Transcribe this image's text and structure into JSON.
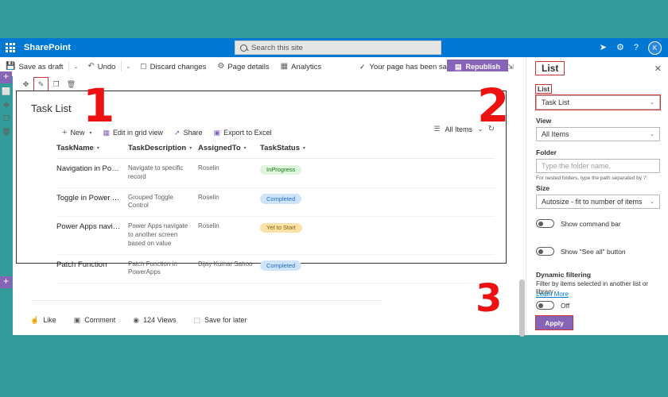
{
  "suite": {
    "waffle_icon": "waffle-icon",
    "brand": "SharePoint",
    "search_placeholder": "Search this site",
    "search_icon": "search-icon",
    "icons": [
      {
        "name": "send-icon",
        "glyph": "➤"
      },
      {
        "name": "gear-icon",
        "glyph": "⚙"
      },
      {
        "name": "help-icon",
        "glyph": "?"
      }
    ],
    "avatar_initial": "K"
  },
  "command_bar": {
    "save_as_draft": "Save as draft",
    "save_icon": "save-icon",
    "save_caret": "⌄",
    "undo": "Undo",
    "undo_icon": "undo-icon",
    "undo_caret": "⌄",
    "discard_changes": "Discard changes",
    "discard_icon": "discard-icon",
    "page_details": "Page details",
    "page_details_icon": "info-icon",
    "analytics": "Analytics",
    "analytics_icon": "analytics-icon",
    "saved_message": "Your page has been saved",
    "saved_check": "✓",
    "republish": "Republish",
    "republish_icon": "publish-icon",
    "collapse_icon": "collapse-icon"
  },
  "rail": {
    "add_section_top": "+",
    "add_section_bottom": "+",
    "icons": [
      {
        "name": "section-comment-icon",
        "glyph": "⬜"
      },
      {
        "name": "move-section-icon",
        "glyph": "✥"
      },
      {
        "name": "duplicate-section-icon",
        "glyph": "❐"
      },
      {
        "name": "delete-section-icon",
        "glyph": "🗑"
      }
    ]
  },
  "webpart_toolbar": {
    "move_icon": "move-webpart-icon",
    "edit_icon": "edit-webpart-icon",
    "duplicate_icon": "duplicate-webpart-icon",
    "delete_icon": "delete-webpart-icon"
  },
  "webpart": {
    "title": "Task List",
    "commands": [
      {
        "label": "New",
        "icon": "plus-icon",
        "caret": true
      },
      {
        "label": "Edit in grid view",
        "icon": "grid-icon",
        "caret": false
      },
      {
        "label": "Share",
        "icon": "share-icon",
        "caret": false
      },
      {
        "label": "Export to Excel",
        "icon": "excel-icon",
        "caret": false
      }
    ],
    "view_name": "All Items",
    "view_icon": "list-view-icon",
    "view_caret": "⌄",
    "refresh_icon": "refresh-icon"
  },
  "table": {
    "columns": [
      "TaskName",
      "TaskDescription",
      "AssignedTo",
      "TaskStatus"
    ],
    "rows": [
      {
        "name": "Navigation in Powe...",
        "description": "Navigate to specific record",
        "assigned": "Roselin",
        "status": "InProgress",
        "status_bg": "#dff6dd",
        "status_fg": "#107c10"
      },
      {
        "name": "Toggle in Power Ap...",
        "description": "Grouped Toggle Control",
        "assigned": "Roselin",
        "status": "Completed",
        "status_bg": "#cfe4fa",
        "status_fg": "#1b6ec2"
      },
      {
        "name": "Power Apps naviga...",
        "description": "Power Apps navigate to another screen based on value",
        "assigned": "Roselin",
        "status": "Yet to Start",
        "status_bg": "#fbe2a8",
        "status_fg": "#8a6100"
      },
      {
        "name": "Patch Function",
        "description": "Patch Function in PowerApps",
        "assigned": "Bijay Kumar Sahoo",
        "status": "Completed",
        "status_bg": "#cfe4fa",
        "status_fg": "#1b6ec2"
      }
    ]
  },
  "social": [
    {
      "label": "Like",
      "icon": "thumbs-up-icon",
      "glyph": "☝"
    },
    {
      "label": "Comment",
      "icon": "comment-icon",
      "glyph": "▣"
    },
    {
      "label": "124 Views",
      "icon": "views-icon",
      "glyph": "◉"
    },
    {
      "label": "Save for later",
      "icon": "bookmark-icon",
      "glyph": "⬚"
    }
  ],
  "pane": {
    "title": "List",
    "close_icon": "close-icon",
    "list_label": "List",
    "list_value": "Task List",
    "view_label": "View",
    "view_value": "All Items",
    "folder_label": "Folder",
    "folder_placeholder": "Type the folder name.",
    "folder_hint": "For nested folders, type the path separated by '/'.",
    "size_label": "Size",
    "size_value": "Autosize - fit to number of items",
    "toggle_command_bar": "Show command bar",
    "toggle_see_all": "Show \"See all\" button",
    "dynamic_filtering_title": "Dynamic filtering",
    "dynamic_filtering_desc": "Filter by items selected in another list or library",
    "learn_more": "Learn More",
    "dynamic_state": "Off",
    "apply": "Apply",
    "caret": "⌄"
  },
  "annotations": {
    "one": "1",
    "two": "2",
    "three": "3"
  }
}
